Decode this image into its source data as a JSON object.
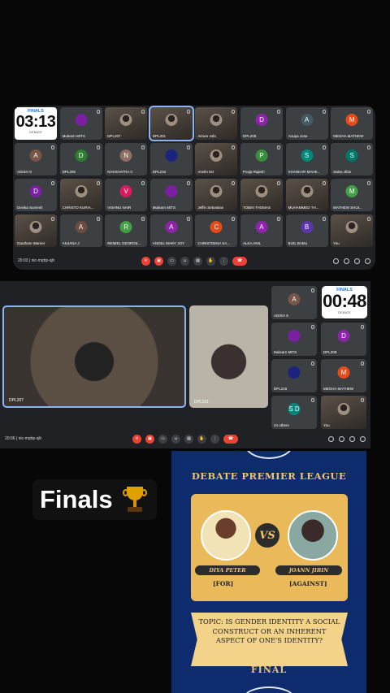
{
  "meet1": {
    "timer": {
      "label": "FINALS",
      "time": "03:13",
      "sub": "DEBATE"
    },
    "tiles": [
      {
        "name": "Mulearn MITS",
        "avatar": "planet",
        "color": "#7b1fa2",
        "type": "logo"
      },
      {
        "name": "DPL207",
        "avatar": "",
        "color": "",
        "type": "photo"
      },
      {
        "name": "DPL201",
        "avatar": "",
        "color": "",
        "type": "photo",
        "active": true
      },
      {
        "name": "Aimee Jobi",
        "avatar": "",
        "color": "",
        "type": "photo"
      },
      {
        "name": "DPL209",
        "avatar": "D",
        "color": "#8e24aa"
      },
      {
        "name": "Anupa Jose",
        "avatar": "A",
        "color": "#455a64"
      },
      {
        "name": "MEGHA MATHEW",
        "avatar": "M",
        "color": "#e64a19"
      },
      {
        "name": "ADISH S",
        "avatar": "A",
        "color": "#795548"
      },
      {
        "name": "DPL206",
        "avatar": "D",
        "color": "#2e7d32"
      },
      {
        "name": "NAKSHATRA C",
        "avatar": "N",
        "color": "#8d6e63"
      },
      {
        "name": "DPL216",
        "avatar": "",
        "color": "#1a237e",
        "type": "logo"
      },
      {
        "name": "Anelin MJ",
        "avatar": "",
        "color": "",
        "type": "photo"
      },
      {
        "name": "Pooja Rajesh",
        "avatar": "P",
        "color": "#388e3c"
      },
      {
        "name": "SHANKAR MAHE...",
        "avatar": "S",
        "color": "#00897b"
      },
      {
        "name": "Salna Jibin",
        "avatar": "S",
        "color": "#00796b"
      },
      {
        "name": "Devika Sumesh",
        "avatar": "D",
        "color": "#7b1fa2"
      },
      {
        "name": "CHRISTO KURIA...",
        "avatar": "",
        "color": "",
        "type": "photo"
      },
      {
        "name": "VISHNU NAIR",
        "avatar": "V",
        "color": "#d81b60"
      },
      {
        "name": "Mulearn MITS",
        "avatar": "planet",
        "color": "#7b1fa2",
        "type": "logo"
      },
      {
        "name": "Jeffin Sebastian",
        "avatar": "",
        "color": "",
        "type": "photo"
      },
      {
        "name": "TOBIN THOMAS",
        "avatar": "",
        "color": "",
        "type": "photo"
      },
      {
        "name": "MUHAMMED TH...",
        "avatar": "",
        "color": "",
        "type": "photo"
      },
      {
        "name": "MATHEW SHIJI...",
        "avatar": "M",
        "color": "#43a047"
      },
      {
        "name": "Gautham Warrier",
        "avatar": "",
        "color": "",
        "type": "photo"
      },
      {
        "name": "ANJANA J",
        "avatar": "A",
        "color": "#6d4c41"
      },
      {
        "name": "REMIEL GEORGE...",
        "avatar": "R",
        "color": "#43a047"
      },
      {
        "name": "ANGEL MARY JOY",
        "avatar": "A",
        "color": "#8e24aa"
      },
      {
        "name": "CHRISTEENA SA...",
        "avatar": "C",
        "color": "#e64a19"
      },
      {
        "name": "ALKA ANIL",
        "avatar": "A",
        "color": "#8e24aa"
      },
      {
        "name": "BIJIL BABU",
        "avatar": "B",
        "color": "#5e35b1"
      },
      {
        "name": "You",
        "avatar": "",
        "color": "",
        "type": "photo"
      }
    ],
    "time_code": "20:03 | nic-mqhp-sjh"
  },
  "meet2": {
    "timer": {
      "label": "FINALS",
      "time": "00:48",
      "sub": "DEBATE"
    },
    "spotlight": [
      {
        "name": "DPL207"
      },
      {
        "name": "DPL201"
      }
    ],
    "side": [
      {
        "name": "ADISH S",
        "avatar": "A",
        "color": "#795548"
      },
      {
        "name": "Mulearn MITS",
        "avatar": "planet",
        "color": "#7b1fa2",
        "type": "logo"
      },
      {
        "name": "DPL209",
        "avatar": "D",
        "color": "#8e24aa"
      },
      {
        "name": "DPL216",
        "avatar": "",
        "color": "#1a237e",
        "type": "logo"
      },
      {
        "name": "MEGHA MATHEW",
        "avatar": "M",
        "color": "#e64a19"
      },
      {
        "name": "24 others",
        "avatar": "S D",
        "color": "#00897b"
      },
      {
        "name": "You",
        "avatar": "",
        "color": "",
        "type": "photo"
      }
    ],
    "time_code": "20:06 | nic-mqhp-sjh"
  },
  "finals_label": "Finals",
  "poster": {
    "heading": "DEBATE PREMIER LEAGUE",
    "vs": "VS",
    "left_name": "DIYA PETER",
    "right_name": "JOANN JIBIN",
    "left_side": "[FOR]",
    "right_side": "[AGAINST]",
    "topic": "TOPIC: IS GENDER IDENTITY A SOCIAL CONSTRUCT OR AN INHERENT ASPECT OF ONE'S IDENTITY?",
    "footer": "FINAL"
  },
  "colors": {
    "meet_bg": "#202124",
    "tile": "#3c4043",
    "end_call": "#ea4335",
    "poster_bg": "#0e2b6e",
    "gold": "#f0c566"
  }
}
